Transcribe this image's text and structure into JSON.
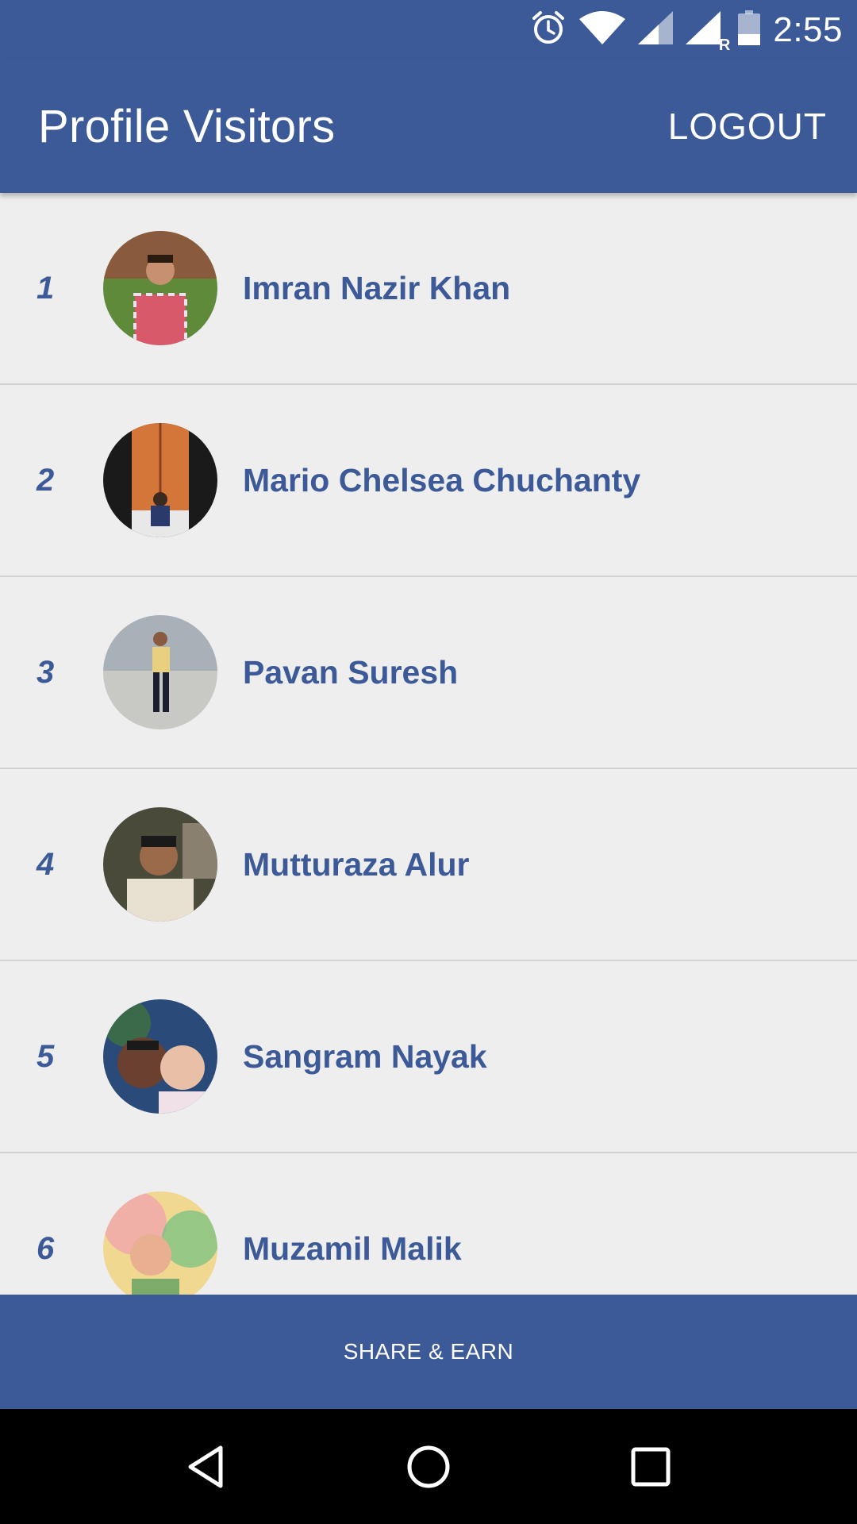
{
  "status_bar": {
    "time": "2:55",
    "icons": [
      "alarm-icon",
      "wifi-icon",
      "signal-icon",
      "signal-roaming-icon",
      "battery-icon"
    ],
    "roaming_label": "R"
  },
  "app_bar": {
    "title": "Profile Visitors",
    "logout_label": "LOGOUT"
  },
  "visitors": [
    {
      "rank": "1",
      "name": "Imran Nazir Khan"
    },
    {
      "rank": "2",
      "name": "Mario Chelsea Chuchanty"
    },
    {
      "rank": "3",
      "name": "Pavan Suresh"
    },
    {
      "rank": "4",
      "name": "Mutturaza Alur"
    },
    {
      "rank": "5",
      "name": "Sangram Nayak"
    },
    {
      "rank": "6",
      "name": "Muzamil Malik"
    }
  ],
  "bottom_bar": {
    "label": "SHARE & EARN"
  },
  "nav_bar": {
    "icons": [
      "back-icon",
      "home-icon",
      "recents-icon"
    ]
  },
  "colors": {
    "primary": "#3d5a98",
    "background": "#eeeeef",
    "divider": "#d3d3d5"
  }
}
